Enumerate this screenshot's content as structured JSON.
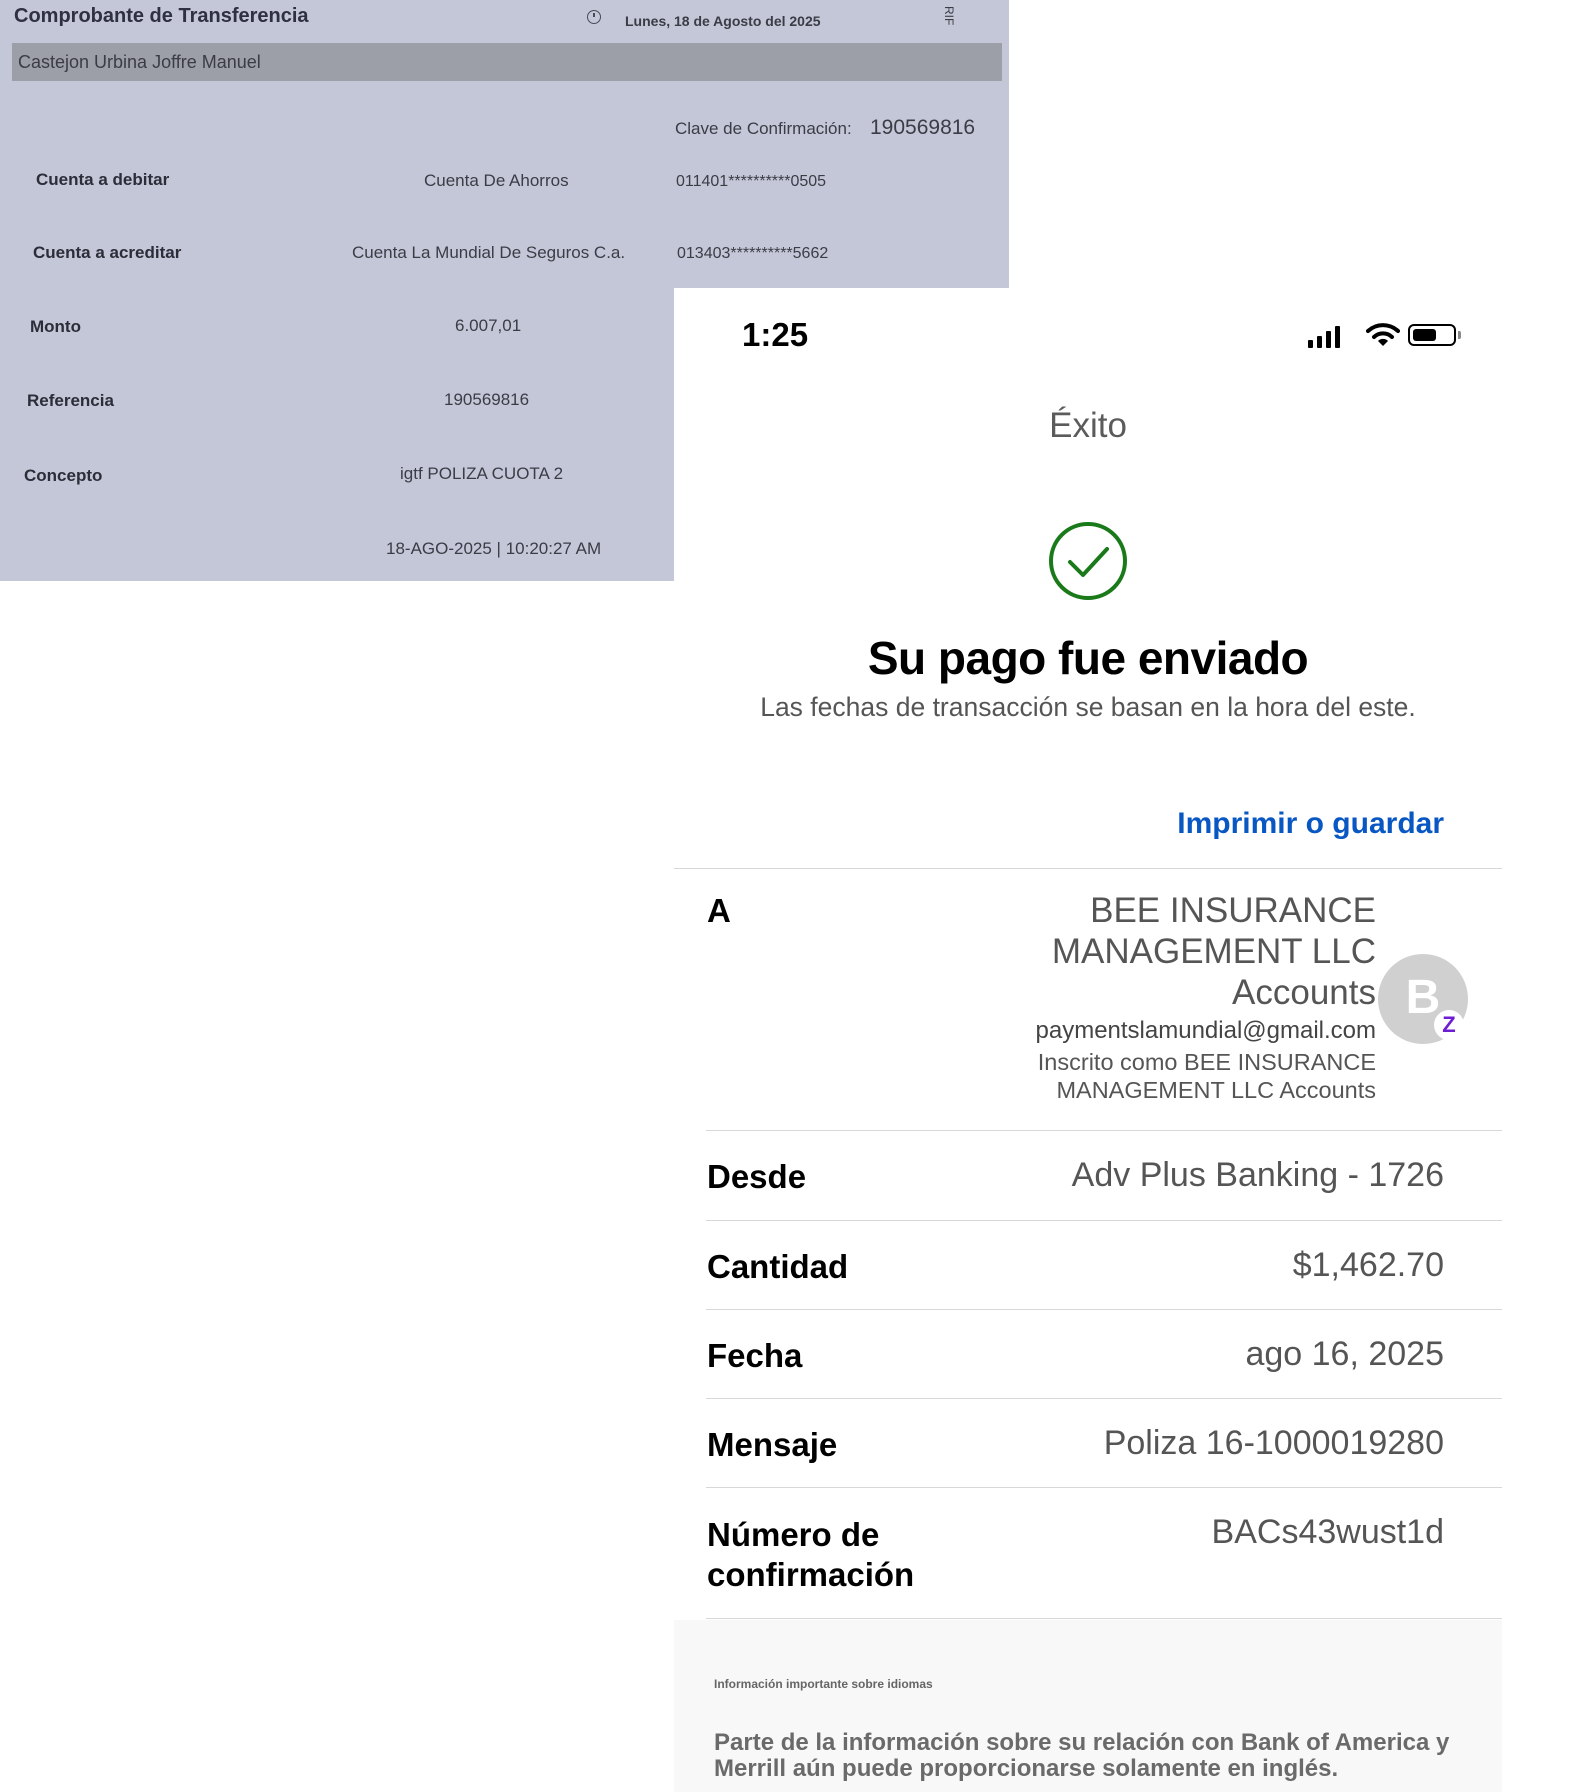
{
  "receipt": {
    "title": "Comprobante de Transferencia",
    "date": "Lunes, 18 de Agosto del 2025",
    "rif_label": "RIF",
    "holder": "Castejon Urbina Joffre Manuel",
    "confirmation_label": "Clave de Confirmación:",
    "confirmation_value": "190569816",
    "rows": [
      {
        "label": "Cuenta a debitar",
        "value": "Cuenta De Ahorros",
        "extra": "011401**********0505"
      },
      {
        "label": "Cuenta a acreditar",
        "value": "Cuenta  La Mundial De Seguros C.a.",
        "extra": "013403**********5662"
      },
      {
        "label": "Monto",
        "value": "6.007,01"
      },
      {
        "label": "Referencia",
        "value": "190569816"
      },
      {
        "label": "Concepto",
        "value": "igtf POLIZA CUOTA 2"
      }
    ],
    "timestamp": "18-AGO-2025 | 10:20:27 AM"
  },
  "phone": {
    "status": {
      "time": "1:25",
      "battery_level": 0.6
    },
    "nav_title": "Éxito",
    "headline": "Su pago fue enviado",
    "subline": "Las fechas de transacción se basan en la hora del este.",
    "print_link": "Imprimir o guardar",
    "to": {
      "label": "A",
      "name": "BEE INSURANCE MANAGEMENT LLC Accounts",
      "email": "paymentslamundial@gmail.com",
      "enrolled": "Inscrito como BEE INSURANCE MANAGEMENT LLC Accounts",
      "avatar_letter": "B",
      "badge": "Z"
    },
    "details": [
      {
        "label": "Desde",
        "value": "Adv Plus Banking - 1726"
      },
      {
        "label": "Cantidad",
        "value": "$1,462.70"
      },
      {
        "label": "Fecha",
        "value": "ago 16, 2025"
      },
      {
        "label": "Mensaje",
        "value": "Poliza 16-1000019280"
      },
      {
        "label": "Número de confirmación",
        "value": "BACs43wust1d"
      }
    ],
    "disclosure": {
      "heading": "Información importante sobre idiomas",
      "text": "Parte de la información sobre su relación con Bank of America y Merrill aún puede proporcionarse solamente en inglés."
    },
    "colors": {
      "link": "#0857c3",
      "success": "#1a7a1a",
      "zelle": "#6d1ed4"
    }
  }
}
